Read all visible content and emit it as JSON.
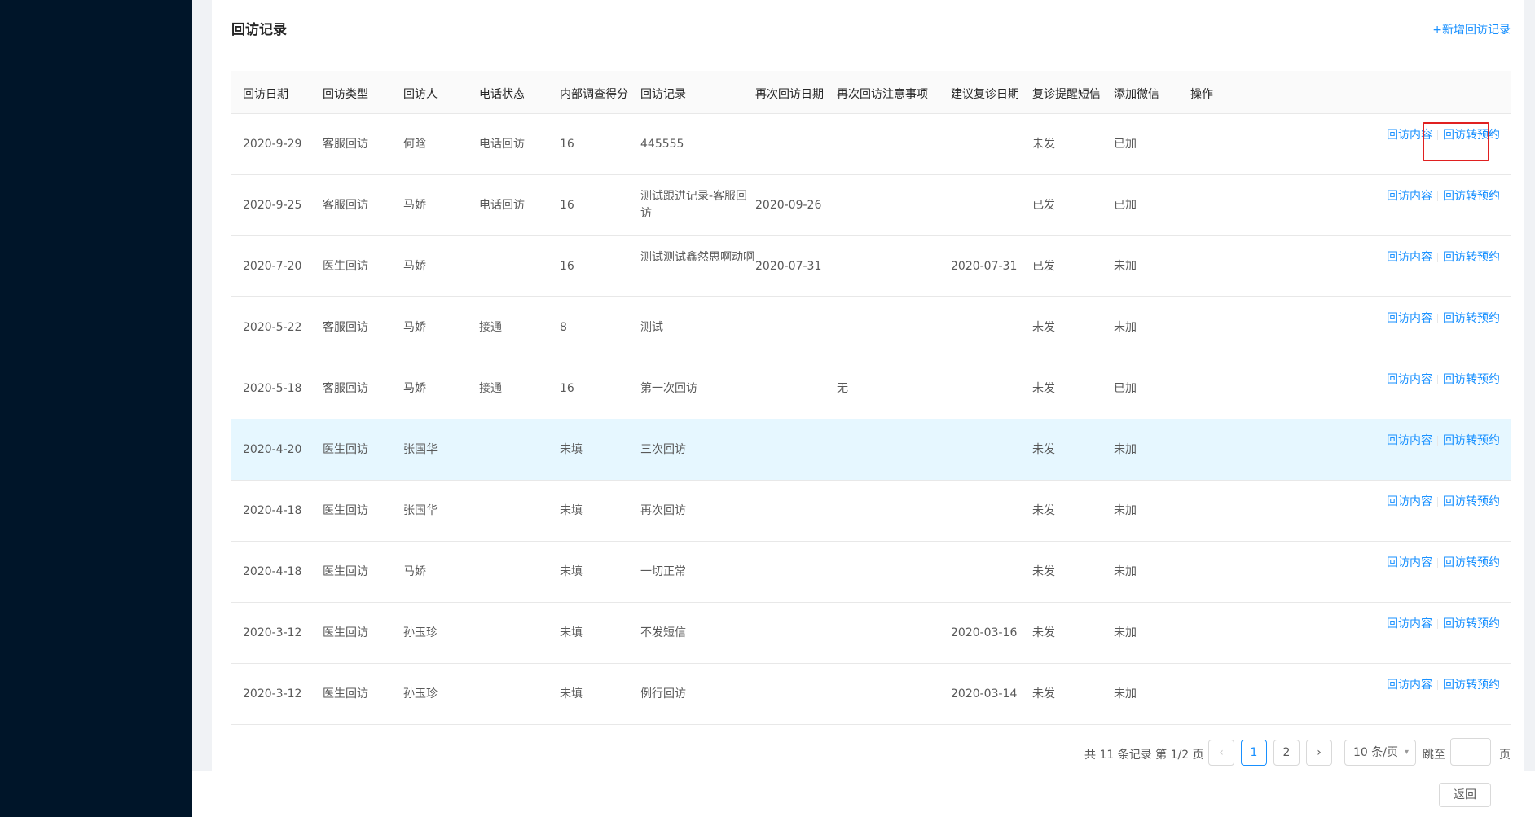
{
  "card": {
    "title": "回访记录",
    "add_link": "+新增回访记录"
  },
  "table": {
    "columns": [
      "回访日期",
      "回访类型",
      "回访人",
      "电话状态",
      "内部调查得分",
      "回访记录",
      "再次回访日期",
      "再次回访注意事项",
      "建议复诊日期",
      "复诊提醒短信",
      "添加微信",
      "操作"
    ],
    "rows": [
      {
        "date": "2020-9-29",
        "type": "客服回访",
        "person": "何晗",
        "phone": "电话回访",
        "score": "16",
        "record": "445555",
        "next_date": "",
        "note": "",
        "revisit": "",
        "sms": "未发",
        "wechat": "已加"
      },
      {
        "date": "2020-9-25",
        "type": "客服回访",
        "person": "马娇",
        "phone": "电话回访",
        "score": "16",
        "record": "测试跟进记录-客服回访",
        "next_date": "2020-09-26",
        "note": "",
        "revisit": "",
        "sms": "已发",
        "wechat": "已加"
      },
      {
        "date": "2020-7-20",
        "type": "医生回访",
        "person": "马娇",
        "phone": "",
        "score": "16",
        "record": "测试测试鑫然思啊动啊",
        "next_date": "2020-07-31",
        "note": "",
        "revisit": "2020-07-31",
        "sms": "已发",
        "wechat": "未加"
      },
      {
        "date": "2020-5-22",
        "type": "客服回访",
        "person": "马娇",
        "phone": "接通",
        "score": "8",
        "record": "测试",
        "next_date": "",
        "note": "",
        "revisit": "",
        "sms": "未发",
        "wechat": "未加"
      },
      {
        "date": "2020-5-18",
        "type": "客服回访",
        "person": "马娇",
        "phone": "接通",
        "score": "16",
        "record": "第一次回访",
        "next_date": "",
        "note": "无",
        "revisit": "",
        "sms": "未发",
        "wechat": "已加"
      },
      {
        "date": "2020-4-20",
        "type": "医生回访",
        "person": "张国华",
        "phone": "",
        "score": "未填",
        "record": "三次回访",
        "next_date": "",
        "note": "",
        "revisit": "",
        "sms": "未发",
        "wechat": "未加"
      },
      {
        "date": "2020-4-18",
        "type": "医生回访",
        "person": "张国华",
        "phone": "",
        "score": "未填",
        "record": "再次回访",
        "next_date": "",
        "note": "",
        "revisit": "",
        "sms": "未发",
        "wechat": "未加"
      },
      {
        "date": "2020-4-18",
        "type": "医生回访",
        "person": "马娇",
        "phone": "",
        "score": "未填",
        "record": "一切正常",
        "next_date": "",
        "note": "",
        "revisit": "",
        "sms": "未发",
        "wechat": "未加"
      },
      {
        "date": "2020-3-12",
        "type": "医生回访",
        "person": "孙玉珍",
        "phone": "",
        "score": "未填",
        "record": "不发短信",
        "next_date": "",
        "note": "",
        "revisit": "2020-03-16",
        "sms": "未发",
        "wechat": "未加"
      },
      {
        "date": "2020-3-12",
        "type": "医生回访",
        "person": "孙玉珍",
        "phone": "",
        "score": "未填",
        "record": "例行回访",
        "next_date": "",
        "note": "",
        "revisit": "2020-03-14",
        "sms": "未发",
        "wechat": "未加"
      }
    ],
    "actions": {
      "content": "回访内容",
      "to_booking": "回访转预约"
    },
    "highlighted_row_index": 5
  },
  "pagination": {
    "total_text": "共 11 条记录 第 1/2 页",
    "pages": [
      "1",
      "2"
    ],
    "current": "1",
    "prev": "‹",
    "next": "›",
    "page_size": "10 条/页",
    "jump_label": "跳至",
    "page_unit": "页"
  },
  "footer": {
    "back_label": "返回"
  },
  "colors": {
    "sidebar": "#001529",
    "link": "#1890ff",
    "highlight_row": "#e6f7ff",
    "annotation_box": "#e02020"
  }
}
